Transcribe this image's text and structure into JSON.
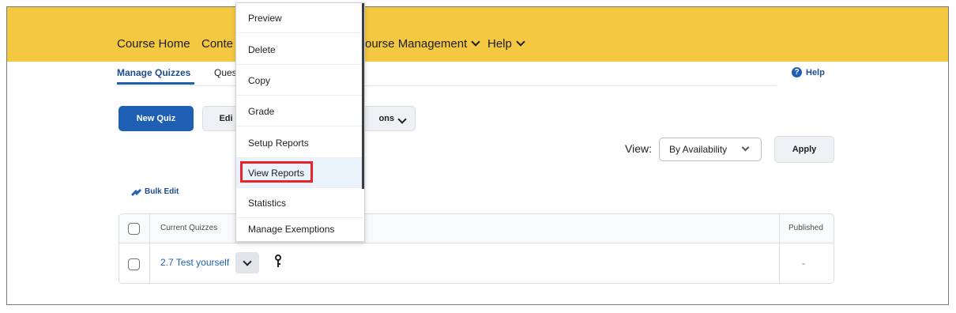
{
  "navbar": {
    "items": [
      "Course Home",
      "Conte",
      "ourse Management",
      "Help"
    ]
  },
  "tabs": {
    "manage": "Manage Quizzes",
    "questions": "Ques"
  },
  "help": {
    "label": "Help"
  },
  "toolbar": {
    "new_quiz": "New Quiz",
    "edit": "Edi",
    "more_actions": "ons"
  },
  "view": {
    "label": "View:",
    "selected": "By Availability",
    "apply": "Apply"
  },
  "bulk_edit": "Bulk Edit",
  "table": {
    "col_current": "Current Quizzes",
    "col_published": "Published",
    "rows": [
      {
        "name": "2.7 Test yourself",
        "published": "-"
      }
    ]
  },
  "context_menu": {
    "items": [
      "Preview",
      "Delete",
      "Copy",
      "Grade",
      "Setup Reports",
      "View Reports",
      "Statistics",
      "Manage Exemptions"
    ]
  },
  "colors": {
    "navbar": "#f4c840",
    "primary": "#1f5fb3",
    "highlight_border": "#e8232a"
  }
}
